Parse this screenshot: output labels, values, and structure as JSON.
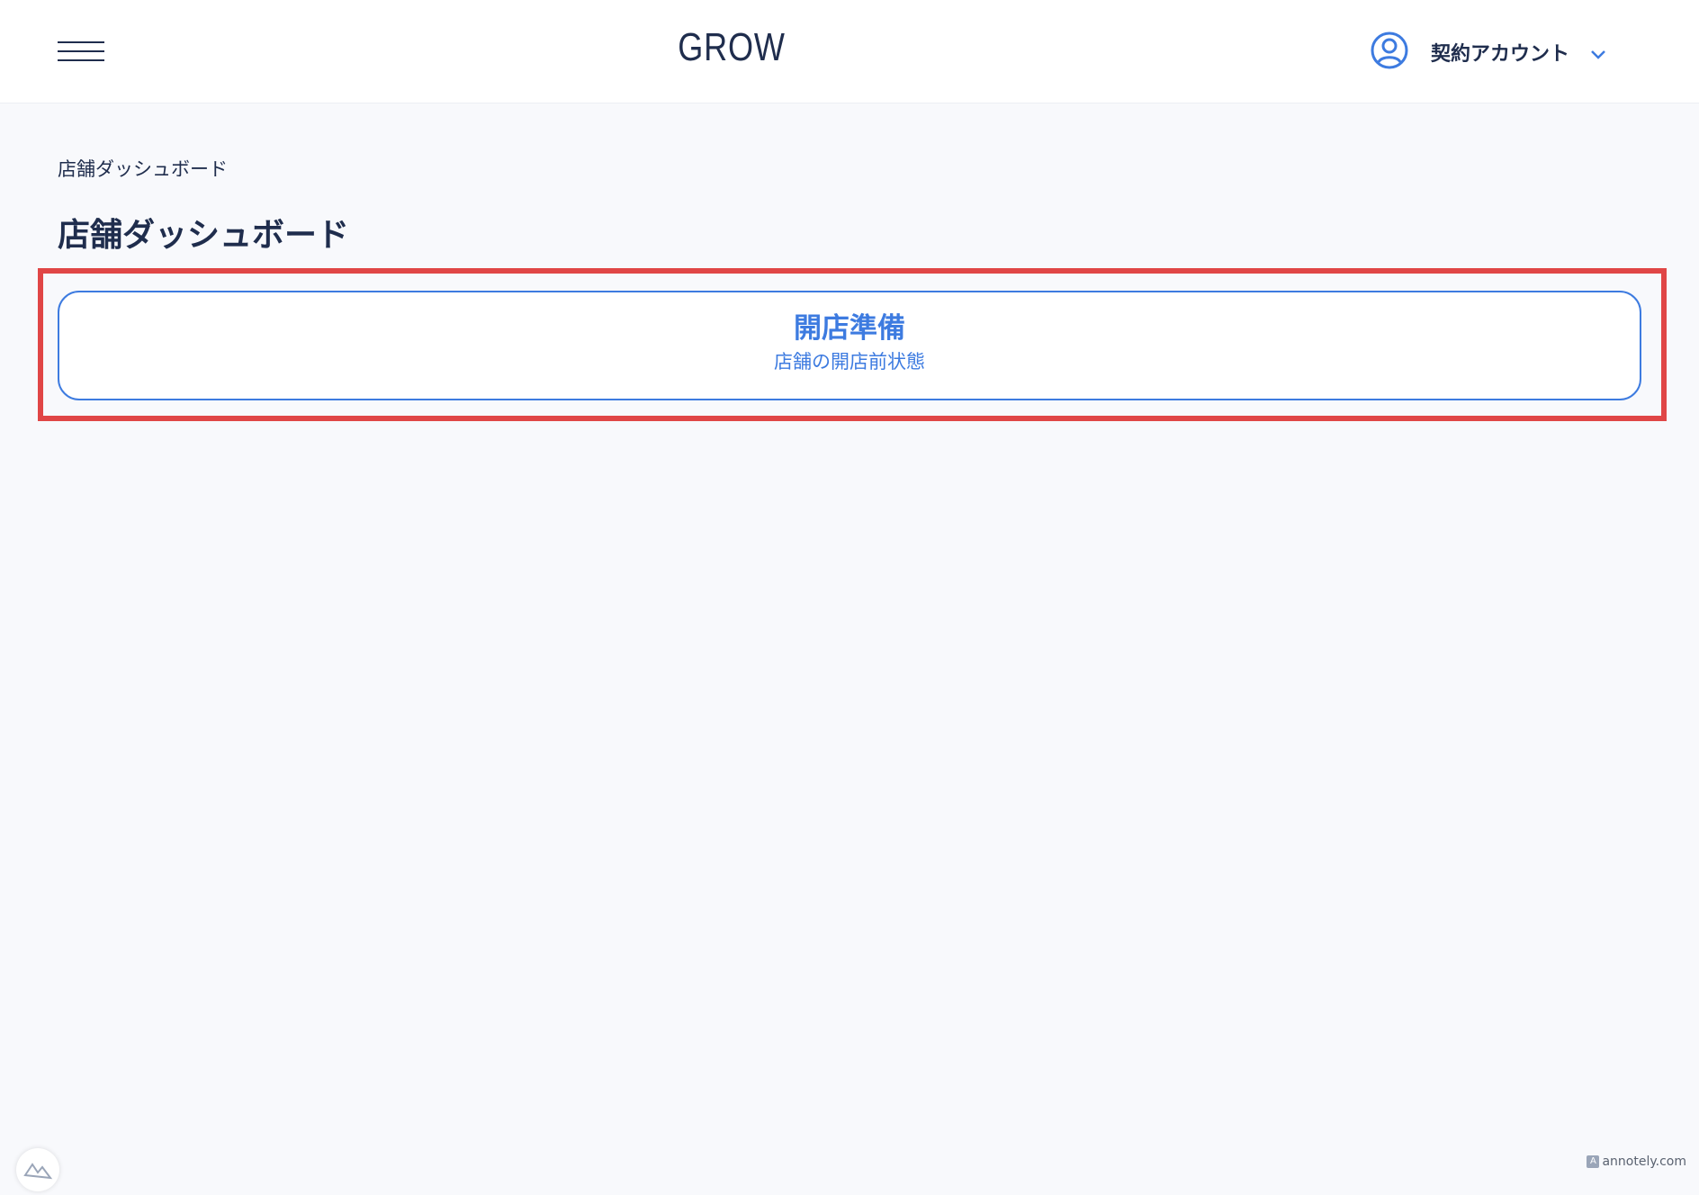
{
  "header": {
    "logo": "GROW",
    "account_label": "契約アカウント",
    "colors": {
      "accent": "#3d7be0",
      "text": "#1f2d4d"
    }
  },
  "main": {
    "breadcrumb": "店舗ダッシュボード",
    "title": "店舗ダッシュボード",
    "status_card": {
      "title": "開店準備",
      "subtitle": "店舗の開店前状態"
    },
    "highlight_color": "#e04646"
  },
  "footer": {
    "watermark": "annotely.com"
  },
  "icons": {
    "menu": "hamburger-menu-icon",
    "account": "user-circle-icon",
    "dropdown": "chevron-down-icon",
    "corner": "nuxt-logo-icon"
  }
}
